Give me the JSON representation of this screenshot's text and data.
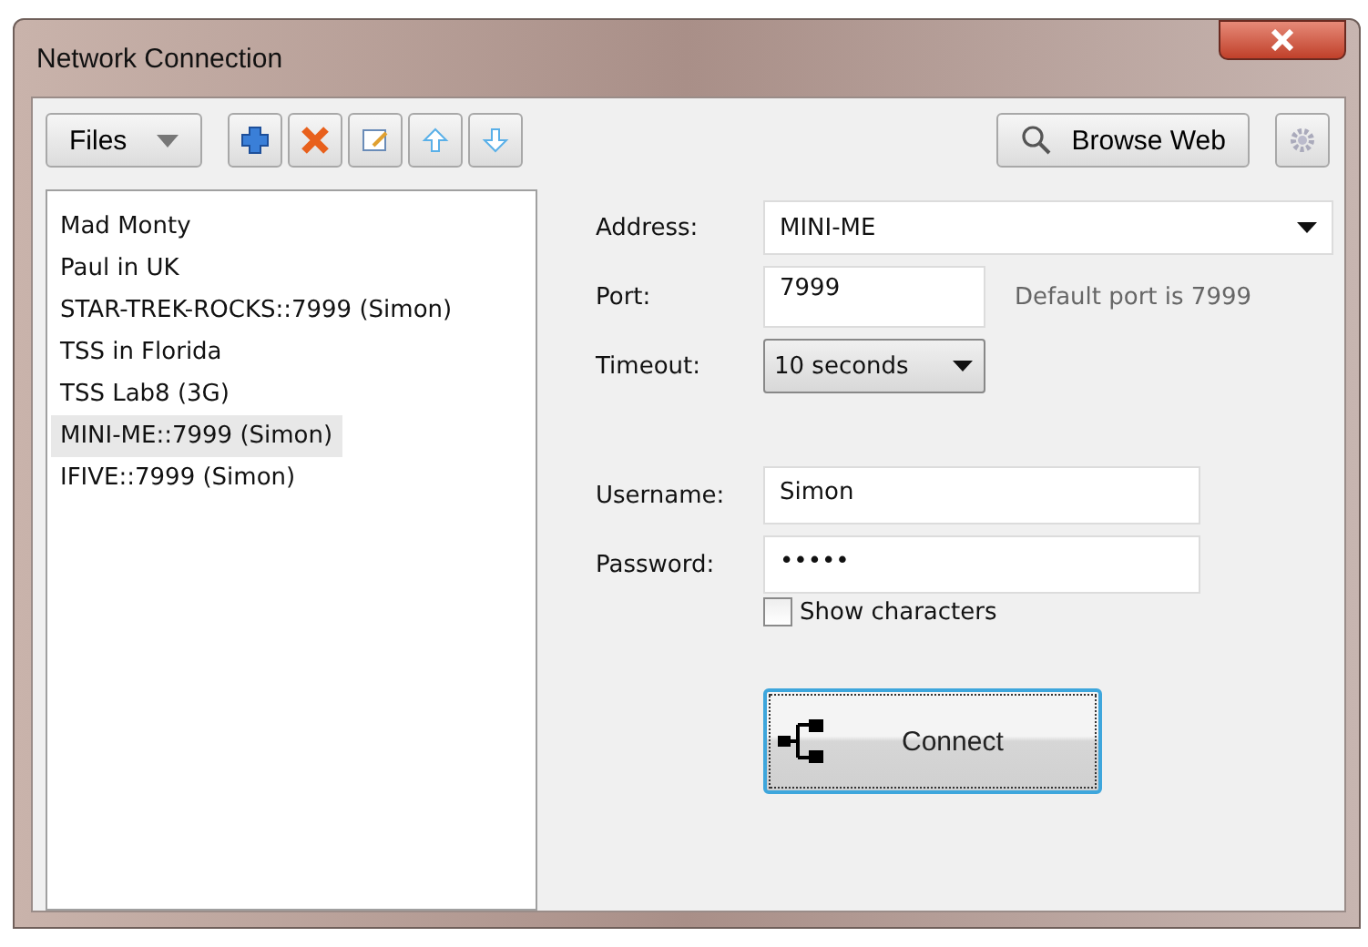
{
  "window": {
    "title": "Network Connection"
  },
  "toolbar": {
    "files_menu": "Files",
    "browse_button": "Browse Web"
  },
  "connections": [
    {
      "name": "Mad Monty",
      "selected": false
    },
    {
      "name": "Paul in UK",
      "selected": false
    },
    {
      "name": "STAR-TREK-ROCKS::7999 (Simon)",
      "selected": false
    },
    {
      "name": "TSS in Florida",
      "selected": false
    },
    {
      "name": "TSS Lab8 (3G)",
      "selected": false
    },
    {
      "name": "MINI-ME::7999 (Simon)",
      "selected": true
    },
    {
      "name": "IFIVE::7999 (Simon)",
      "selected": false
    }
  ],
  "form": {
    "address": {
      "label": "Address:",
      "value": "MINI-ME"
    },
    "port": {
      "label": "Port:",
      "value": "7999",
      "hint": "Default port is 7999"
    },
    "timeout": {
      "label": "Timeout:",
      "value": "10 seconds"
    },
    "username": {
      "label": "Username:",
      "value": "Simon"
    },
    "password": {
      "label": "Password:",
      "value": "•••••"
    },
    "show_characters": {
      "label": "Show characters",
      "checked": false
    }
  },
  "connect_button": "Connect"
}
